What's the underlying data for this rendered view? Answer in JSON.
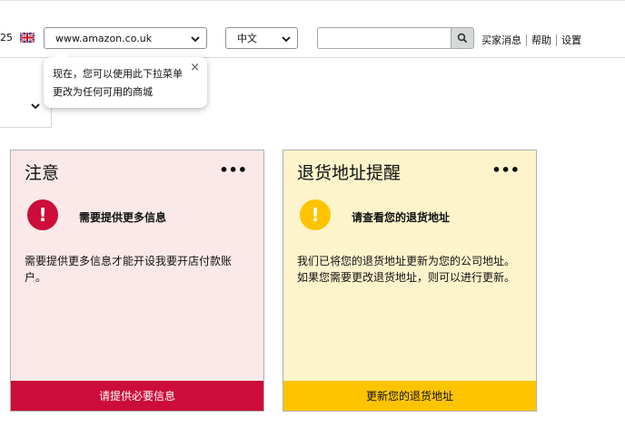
{
  "header": {
    "date_fragment": "25",
    "flag_icon": "uk-flag-icon",
    "store_select": {
      "value": "www.amazon.co.uk"
    },
    "language_select": {
      "value": "中文"
    },
    "search": {
      "value": "",
      "icon": "search-icon"
    },
    "links": [
      {
        "label": "买家消息"
      },
      {
        "label": "帮助"
      },
      {
        "label": "设置"
      }
    ]
  },
  "tooltip": {
    "text": "现在，您可以使用此下拉菜单更改为任何可用的商城",
    "close": "×"
  },
  "cards": {
    "notice": {
      "title": "注意",
      "menu": "•••",
      "icon_glyph": "!",
      "alert_label": "需要提供更多信息",
      "body": "需要提供更多信息才能开设我要开店付款账户。",
      "button_label": "请提供必要信息",
      "color": "#cc0c39"
    },
    "return_address": {
      "title": "退货地址提醒",
      "menu": "•••",
      "icon_glyph": "!",
      "alert_label": "请查看您的退货地址",
      "body": "我们已将您的退货地址更新为您的公司地址。如果您需要更改退货地址，则可以进行更新。",
      "button_label": "更新您的退货地址",
      "color": "#ffc400"
    }
  }
}
